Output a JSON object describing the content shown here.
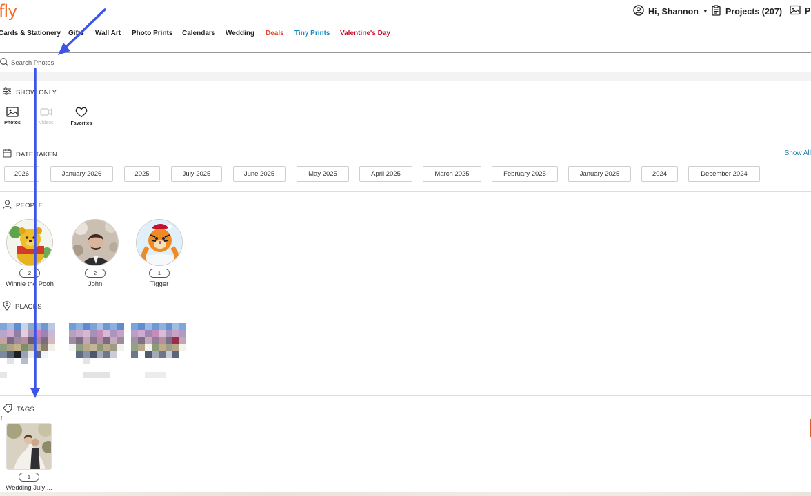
{
  "brand": {
    "logo_text": "fly",
    "color": "#f26b2a"
  },
  "header": {
    "greeting": "Hi, Shannon",
    "projects_label": "Projects (207)",
    "photos_label": "Ph"
  },
  "nav": {
    "items": [
      {
        "label": "Cards & Stationery",
        "color": "#222222"
      },
      {
        "label": "Gifts",
        "color": "#222222"
      },
      {
        "label": "Wall Art",
        "color": "#222222"
      },
      {
        "label": "Photo Prints",
        "color": "#222222"
      },
      {
        "label": "Calendars",
        "color": "#222222"
      },
      {
        "label": "Wedding",
        "color": "#222222"
      },
      {
        "label": "Deals",
        "color": "#e8462a"
      },
      {
        "label": "Tiny Prints",
        "color": "#1a8ac0"
      },
      {
        "label": "Valentine's Day",
        "color": "#c8102e"
      }
    ]
  },
  "search": {
    "placeholder": "Search Photos"
  },
  "show_only": {
    "heading": "SHOW ONLY",
    "filters": [
      {
        "label": "Photos",
        "state": "active"
      },
      {
        "label": "Videos",
        "state": "disabled"
      },
      {
        "label": "Favorites",
        "state": "active"
      }
    ]
  },
  "date_taken": {
    "heading": "DATE TAKEN",
    "show_all": "Show All",
    "chips": [
      "2026",
      "January 2026",
      "2025",
      "July 2025",
      "June 2025",
      "May 2025",
      "April 2025",
      "March 2025",
      "February 2025",
      "January 2025",
      "2024",
      "December 2024"
    ]
  },
  "people": {
    "heading": "PEOPLE",
    "items": [
      {
        "name": "Winnie the Pooh",
        "count": "2"
      },
      {
        "name": "John",
        "count": "2"
      },
      {
        "name": "Tigger",
        "count": "1"
      }
    ]
  },
  "places": {
    "heading": "PLACES"
  },
  "tags": {
    "heading": "TAGS",
    "items": [
      {
        "name": "Wedding July ...",
        "count": "1"
      }
    ]
  },
  "annotation": {
    "arrow_color": "#3d55e6"
  }
}
